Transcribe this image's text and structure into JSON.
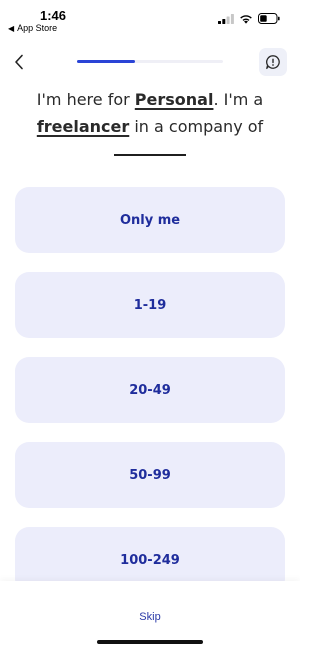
{
  "status_bar": {
    "time": "1:46",
    "back_app_label": "App Store"
  },
  "header": {
    "progress_fraction": 0.4
  },
  "question": {
    "part1": "I'm here for ",
    "purpose": "Personal",
    "part2": ". I'm a ",
    "role": "freelancer",
    "part3": " in a company of"
  },
  "options": [
    {
      "label": "Only me"
    },
    {
      "label": "1-19"
    },
    {
      "label": "20-49"
    },
    {
      "label": "50-99"
    },
    {
      "label": "100-249"
    }
  ],
  "footer": {
    "skip_label": "Skip"
  },
  "colors": {
    "accent": "#2a44d6",
    "option_bg": "#ecedfb",
    "option_text": "#1f2d9c"
  },
  "icons": {
    "back": "chevron-left-icon",
    "feedback": "speech-bubble-exclamation-icon",
    "signal": "cellular-signal-icon",
    "wifi": "wifi-icon",
    "battery": "battery-icon"
  }
}
